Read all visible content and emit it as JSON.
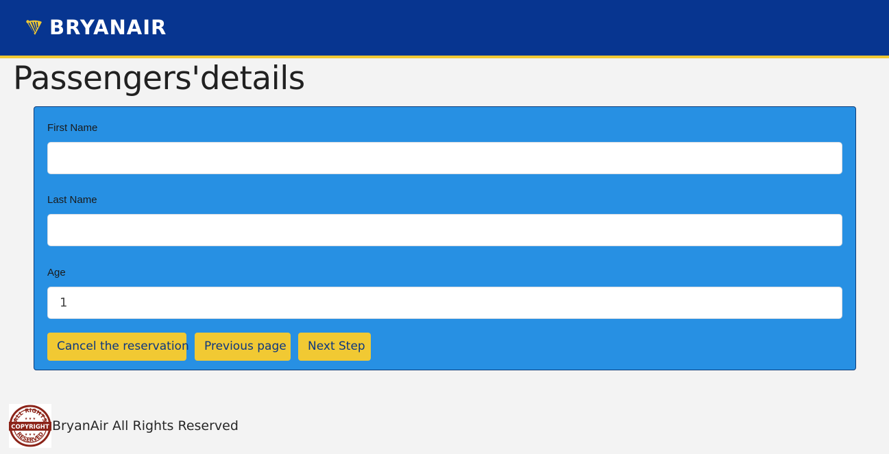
{
  "header": {
    "brand": "BRYANAIR",
    "logo_icon": "harp-icon",
    "colors": {
      "background": "#073590",
      "accent": "#f1c933"
    }
  },
  "page": {
    "title": "Passengers'details"
  },
  "form": {
    "card_color": "#2790e3",
    "fields": {
      "first_name": {
        "label": "First Name",
        "value": ""
      },
      "last_name": {
        "label": "Last Name",
        "value": ""
      },
      "age": {
        "label": "Age",
        "value": "1"
      }
    },
    "buttons": {
      "cancel": "Cancel the reservation",
      "previous": "Previous page",
      "next": "Next Step"
    },
    "button_color": "#f1c933"
  },
  "footer": {
    "badge": {
      "icon": "copyright-stamp-icon",
      "text_top": "ALL RIGHTS",
      "text_center": "COPYRIGHT",
      "text_bottom": "RESERVED"
    },
    "text": "BryanAir All Rights Reserved"
  }
}
